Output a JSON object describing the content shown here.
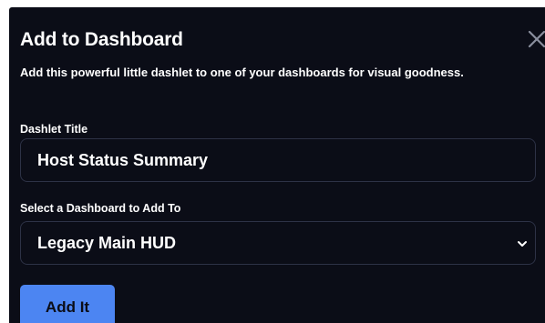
{
  "modal": {
    "title": "Add to Dashboard",
    "description": "Add this powerful little dashlet to one of your dashboards for visual goodness.",
    "close_icon": "close-icon"
  },
  "form": {
    "dashlet_title_label": "Dashlet Title",
    "dashlet_title_value": "Host Status Summary",
    "dashboard_label": "Select a Dashboard to Add To",
    "dashboard_selected": "Legacy Main HUD",
    "submit_label": "Add It"
  },
  "colors": {
    "background": "#0b0d17",
    "field_border": "#2d3246",
    "accent": "#4c85f2",
    "text": "#ffffff"
  }
}
